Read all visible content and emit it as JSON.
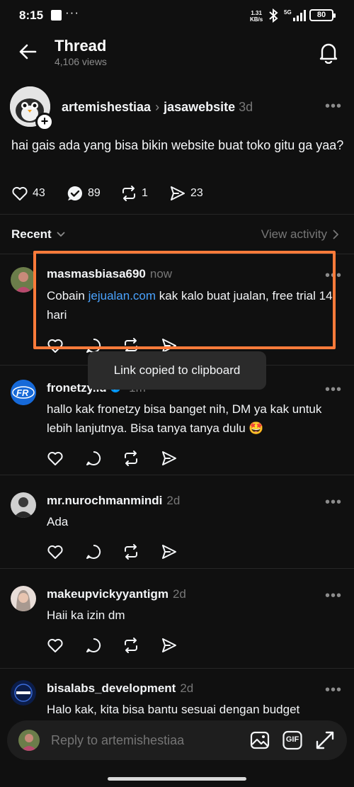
{
  "status_bar": {
    "time": "8:15",
    "dots": "···",
    "speed_value": "1.31",
    "speed_unit": "KB/s",
    "network": "5G",
    "battery": "80"
  },
  "header": {
    "title": "Thread",
    "views": "4,106 views"
  },
  "original_post": {
    "author": "artemishestiaa",
    "separator": "›",
    "community": "jasawebsite",
    "time": "3d",
    "text": "hai gais ada yang bisa bikin website buat toko gitu ga yaa?",
    "likes": "43",
    "replies": "89",
    "reposts": "1",
    "shares": "23"
  },
  "sort": {
    "label": "Recent",
    "view_activity": "View activity"
  },
  "replies": [
    {
      "user": "masmasbiasa690",
      "time": "now",
      "text_before": "Cobain ",
      "link": "jejualan.com",
      "text_after": " kak kalo buat jualan, free trial 14 hari"
    },
    {
      "user": "fronetzy.id",
      "time": "1m",
      "text": "hallo kak fronetzy bisa banget nih, DM ya kak untuk lebih lanjutnya. Bisa tanya tanya dulu 🤩",
      "avatar_text": "FR"
    },
    {
      "user": "mr.nurochmanmindi",
      "time": "2d",
      "text": "Ada"
    },
    {
      "user": "makeupvickyyantigm",
      "time": "2d",
      "text": "Haii ka izin dm"
    },
    {
      "user": "bisalabs_development",
      "time": "2d",
      "text": "Halo kak, kita bisa bantu sesuai dengan budget"
    }
  ],
  "toast": "Link copied to clipboard",
  "composer": {
    "placeholder": "Reply to artemishestiaa",
    "gif_label": "GIF"
  },
  "colors": {
    "background": "#101010",
    "highlight": "#ff7b3a",
    "link": "#4aa3ff",
    "muted": "#777777"
  }
}
